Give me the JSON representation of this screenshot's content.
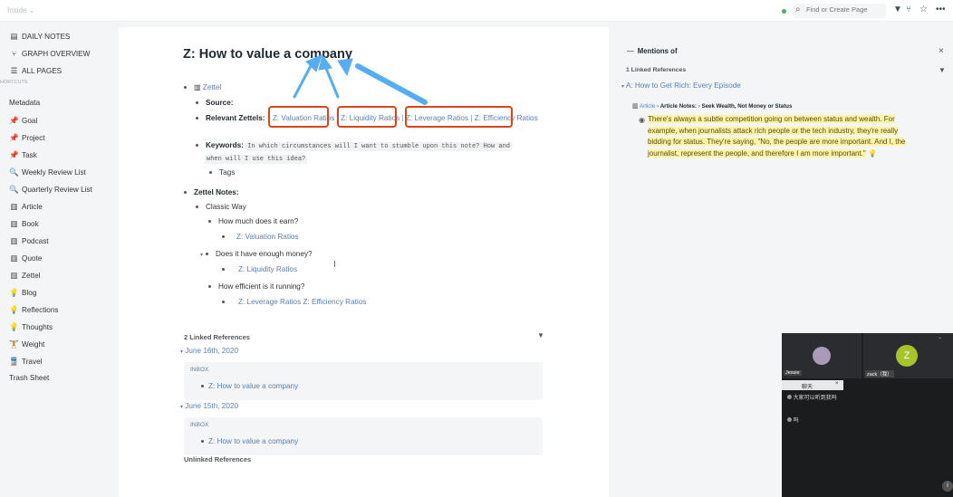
{
  "app": {
    "graph_name": "Inside",
    "search_placeholder": "Find or Create Page"
  },
  "colors": {
    "link": "#5a7fb5",
    "highlight": "#fff4a3",
    "annotation_box": "#d9461a",
    "annotation_arrow": "#56aef0",
    "status_online": "#4caf6a"
  },
  "sidebar": {
    "top": [
      {
        "icon": "calendar-icon",
        "label": "DAILY NOTES"
      },
      {
        "icon": "graph-icon",
        "label": "GRAPH OVERVIEW"
      },
      {
        "icon": "list-icon",
        "label": "ALL PAGES"
      }
    ],
    "shortcuts_label": "HORTCUTS",
    "shortcuts": [
      {
        "icon": "",
        "label": "Metadata"
      },
      {
        "icon": "pin-icon",
        "label": "Goal"
      },
      {
        "icon": "pin-icon",
        "label": "Project"
      },
      {
        "icon": "pin-icon",
        "label": "Task"
      },
      {
        "icon": "magnifier-icon",
        "label": "Weekly Review List"
      },
      {
        "icon": "magnifier-icon",
        "label": "Quarterly Review List"
      },
      {
        "icon": "book-icon",
        "label": "Article"
      },
      {
        "icon": "book-icon",
        "label": "Book"
      },
      {
        "icon": "book-icon",
        "label": "Podcast"
      },
      {
        "icon": "book-icon",
        "label": "Quote"
      },
      {
        "icon": "book-icon",
        "label": "Zettel"
      },
      {
        "icon": "bulb-icon",
        "label": "Blog"
      },
      {
        "icon": "bulb-icon",
        "label": "Reflections"
      },
      {
        "icon": "bulb-icon",
        "label": "Thoughts"
      },
      {
        "icon": "weight-icon",
        "label": "Weight"
      },
      {
        "icon": "travel-icon",
        "label": "Travel"
      },
      {
        "icon": "",
        "label": "Trash Sheet"
      }
    ]
  },
  "page": {
    "title": "Z: How to value a company",
    "zettel_tag": "Zettel",
    "source_label": "Source:",
    "relevant_label": "Relevant Zettels:",
    "relevant_links": [
      "Z: Valuation Ratios",
      "Z: Liquidity Ratios",
      "Z: Leverage Ratios",
      "Z: Efficiency Ratios"
    ],
    "relevant_sep": "|",
    "keywords_label": "Keywords:",
    "keywords_line1": "In which circumstances will I want to stumble upon this note? How and",
    "keywords_line2": "when will I use this idea?",
    "tags_label": "Tags",
    "zettel_notes_label": "Zettel Notes:",
    "classic_way": "Classic Way",
    "q1": "How much does it earn?",
    "q1_link": "Z: Valuation Ratios",
    "q2": "Does it have enough money?",
    "q2_link": "Z: Liquidity Ratios",
    "q3": "How efficient is it running?",
    "q3_links": [
      "Z: Leverage Ratios",
      "Z: Efficiency Ratios"
    ],
    "linked_refs_label": "2 Linked References",
    "refs": [
      {
        "date": "June 16th, 2020",
        "tag": "INBOX",
        "link": "Z: How to value a company"
      },
      {
        "date": "June 15th, 2020",
        "tag": "INBOX",
        "link": "Z: How to value a company"
      }
    ],
    "unlinked_label": "Unlinked References"
  },
  "right_sidebar": {
    "header": "Mentions of",
    "linked_count": "1 Linked References",
    "source_page": "A: How to Get Rich: Every Episode",
    "breadcrumb": [
      "Article",
      "Article Notes:",
      "Seek Wealth, Not Money or Status"
    ],
    "quote_lines": [
      "There's always a subtle competition going on between status and wealth. For",
      "example, when journalists attack rich people or the tech industry, they're really",
      "bidding for status. They're saying, \"No, the people are more important. And I, the",
      "journalist, represent the people, and therefore I am more important.\""
    ]
  },
  "video_call": {
    "participant1": "Jessie",
    "participant2_initial": "Z",
    "participant2": "zack（我）",
    "chat_title": "聊天",
    "chat_messages": [
      "大家可以听到我吗",
      "吗"
    ]
  }
}
